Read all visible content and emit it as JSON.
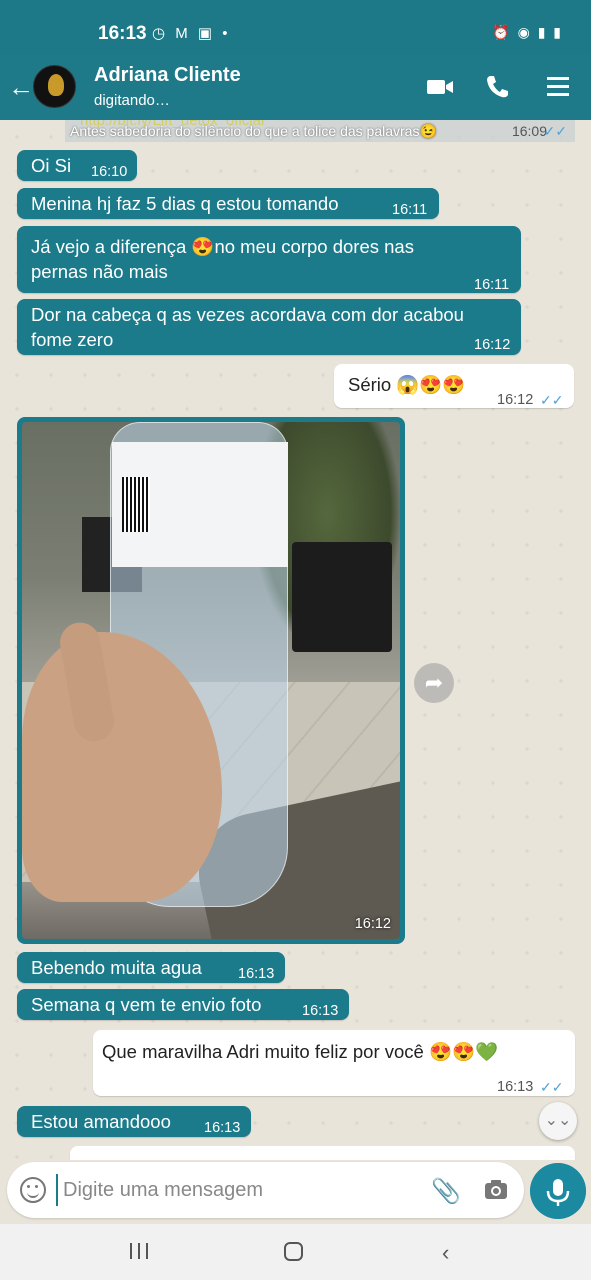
{
  "status_bar": {
    "time": "16:13",
    "left_icons": "◷ M ▣ •",
    "right_icons": "⏰ ◉ ▮ ▮"
  },
  "header": {
    "back_icon": "←",
    "contact_name": "Adriana Cliente",
    "contact_status": "digitando…"
  },
  "pinned": {
    "link": "http://bit.ly/Lift_detox_oficial",
    "text": "Antes sabedoria do silêncio do que a tolice das palavras😉",
    "time": "16:09",
    "ticks": "✓✓"
  },
  "messages": [
    {
      "text": "Oi Si",
      "time": "16:10"
    },
    {
      "text": "Menina hj faz 5 dias q estou tomando",
      "time": "16:11"
    },
    {
      "text_l1": "Já vejo a diferença 😍no meu corpo dores nas",
      "text_l2": "pernas não mais",
      "time": "16:11"
    },
    {
      "text_l1": "Dor na cabeça q as vezes acordava com dor acabou",
      "text_l2": "fome zero",
      "time": "16:12"
    },
    {
      "text": "Sério 😱😍😍",
      "time": "16:12",
      "ticks": "✓✓"
    },
    {
      "image_time": "16:12"
    },
    {
      "text": "Bebendo muita agua",
      "time": "16:13"
    },
    {
      "text": "Semana q vem te envio foto",
      "time": "16:13"
    },
    {
      "text": "Que maravilha Adri muito feliz por você 😍😍💚",
      "time": "16:13",
      "ticks": "✓✓"
    },
    {
      "text": "Estou amandooo",
      "time": "16:13"
    }
  ],
  "share_icon": "➦",
  "scroll_icon": "⌄⌄",
  "input": {
    "placeholder": "Digite uma mensagem",
    "attach_icon": "📎"
  },
  "nav": {
    "back_icon": "‹"
  }
}
